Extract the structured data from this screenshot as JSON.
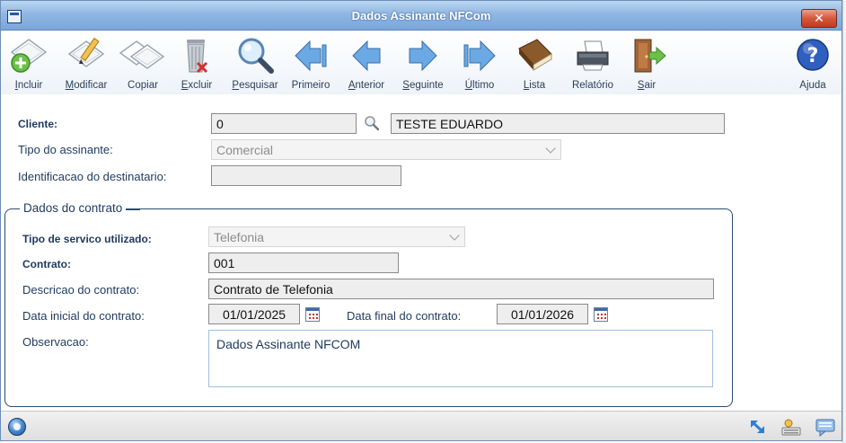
{
  "window": {
    "title": "Dados Assinante NFCom",
    "close_label": "✕"
  },
  "toolbar": [
    {
      "name": "incluir",
      "mnemonic": "I",
      "rest": "ncluir",
      "icon": "add-document-icon"
    },
    {
      "name": "modificar",
      "mnemonic": "M",
      "rest": "odificar",
      "icon": "edit-document-icon"
    },
    {
      "name": "copiar",
      "mnemonic": "",
      "first": "C",
      "underline_idx": 1,
      "label": "Copiar",
      "icon": "copy-documents-icon"
    },
    {
      "name": "excluir",
      "mnemonic": "E",
      "rest": "xcluir",
      "icon": "trash-icon"
    },
    {
      "name": "pesquisar",
      "mnemonic": "P",
      "rest": "esquisar",
      "icon": "magnifier-icon"
    },
    {
      "name": "primeiro",
      "label": "Primeiro",
      "icon": "first-arrow-icon"
    },
    {
      "name": "anterior",
      "mnemonic": "A",
      "rest": "nterior",
      "icon": "previous-arrow-icon"
    },
    {
      "name": "seguinte",
      "mnemonic": "S",
      "rest": "eguinte",
      "icon": "next-arrow-icon"
    },
    {
      "name": "ultimo",
      "mnemonic": "Ú",
      "rest": "ltimo",
      "icon": "last-arrow-icon"
    },
    {
      "name": "lista",
      "mnemonic": "L",
      "rest": "ista",
      "icon": "book-icon"
    },
    {
      "name": "relatorio",
      "label": "Relatório",
      "icon": "printer-icon"
    },
    {
      "name": "sair",
      "mnemonic": "S",
      "rest": "air",
      "icon": "exit-door-icon"
    },
    {
      "name": "ajuda",
      "label": "Ajuda",
      "icon": "help-icon"
    }
  ],
  "form": {
    "cliente_label": "Cliente:",
    "cliente_code": "0",
    "cliente_name": "TESTE EDUARDO",
    "tipo_assinante_label": "Tipo do assinante:",
    "tipo_assinante_value": "Comercial",
    "identificacao_label": "Identificacao do destinatario:",
    "identificacao_value": "",
    "group_title": "Dados do contrato",
    "tipo_servico_label": "Tipo de servico utilizado:",
    "tipo_servico_value": "Telefonia",
    "contrato_label": "Contrato:",
    "contrato_value": "001",
    "descricao_label": "Descricao do contrato:",
    "descricao_value": "Contrato de Telefonia",
    "data_inicial_label": "Data inicial do contrato:",
    "data_inicial_value": "01/01/2025",
    "data_final_label": "Data final do contrato:",
    "data_final_value": "01/01/2026",
    "observacao_label": "Observacao:",
    "observacao_value": "Dados Assinante NFCOM"
  },
  "colors": {
    "label_text": "#1e3a5f",
    "title_gradient_top": "#bcd7f1",
    "title_gradient_bottom": "#79a6da",
    "close_red": "#c23a1e"
  }
}
